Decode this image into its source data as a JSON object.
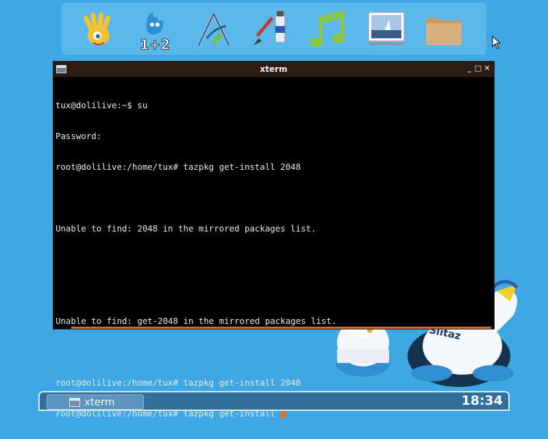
{
  "dock": {
    "items": [
      {
        "name": "hand-wave-icon"
      },
      {
        "name": "math-game-icon",
        "label": "1+2"
      },
      {
        "name": "vector-graphics-icon"
      },
      {
        "name": "paint-brush-icon"
      },
      {
        "name": "music-note-icon"
      },
      {
        "name": "image-viewer-icon"
      },
      {
        "name": "folder-icon"
      }
    ]
  },
  "window": {
    "title": "xterm",
    "minimize_label": "_",
    "maximize_label": "□",
    "close_label": "✕"
  },
  "terminal": {
    "lines": [
      "tux@dolilive:~$ su",
      "Password:",
      "root@dolilive:/home/tux# tazpkg get-install 2048",
      "",
      "Unable to find: 2048 in the mirrored packages list.",
      "",
      "",
      "Unable to find: get-2048 in the mirrored packages list.",
      "",
      "root@dolilive:/home/tux# tazpkg get-install 2048",
      "root@dolilive:/home/tux# tazpkg get-install "
    ],
    "cursor_color": "#e06c2e"
  },
  "desktop": {
    "mascot_text": "Slitaz"
  },
  "taskbar": {
    "task_label": "xterm",
    "clock": "18:34"
  },
  "colors": {
    "desktop_bg": "#3fa7e3",
    "titlebar": "#2d1b14",
    "taskbar": "#2f6f9a"
  }
}
